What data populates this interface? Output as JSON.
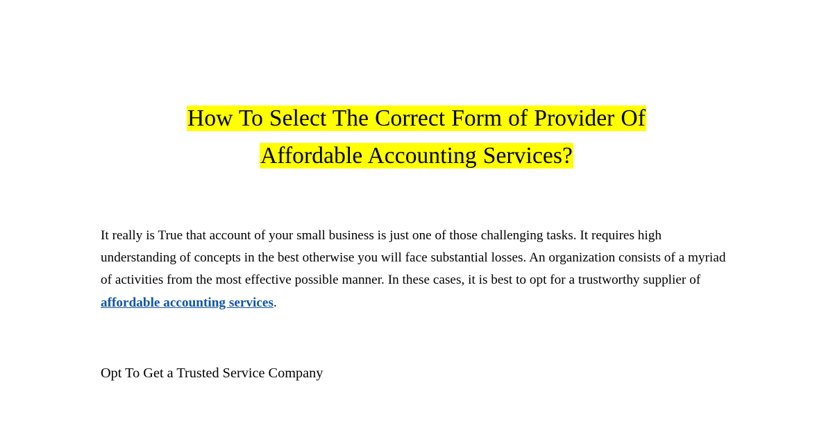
{
  "document": {
    "background_color": "#ffffff",
    "text_color": "#000000",
    "highlight_color": "#ffff00",
    "link_color": "#1155a8",
    "title": {
      "line1": "How To Select The Correct Form of Provider Of",
      "line2": "Affordable Accounting Services?",
      "full": "How To Select The Correct Form of Provider Of Affordable Accounting Services?"
    },
    "paragraph": {
      "part1": "It really is True that account of your small business is just one of those challenging tasks. It requires high understanding of concepts in the best otherwise you will face substantial losses. An organization consists of a myriad of activities from the most effective possible manner. In these cases, it is best to opt for a trustworthy supplier of ",
      "link_text": "affordable accounting services",
      "part2": "."
    },
    "subheading": "Opt To Get a Trusted Service Company"
  }
}
